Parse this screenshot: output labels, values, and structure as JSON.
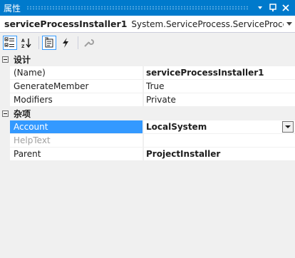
{
  "window": {
    "title": "属性",
    "buttons": {
      "dropdown": "▾",
      "pin": "▭",
      "close": "✕"
    }
  },
  "object_selector": {
    "name": "serviceProcessInstaller1",
    "type": "System.ServiceProcess.ServiceProcessInsta"
  },
  "toolbar": {
    "items": [
      {
        "id": "categorized",
        "icon": "categorized-icon",
        "active": true
      },
      {
        "id": "alphabetical",
        "icon": "alphabetical-icon",
        "active": false
      },
      {
        "id": "properties",
        "icon": "properties-icon",
        "active": true
      },
      {
        "id": "events",
        "icon": "events-lightning-icon",
        "active": false
      },
      {
        "id": "property-pages",
        "icon": "property-pages-wrench-icon",
        "active": false
      }
    ]
  },
  "grid": {
    "categories": [
      {
        "label": "设计",
        "expander": "⊟",
        "properties": [
          {
            "name": "(Name)",
            "value": "serviceProcessInstaller1"
          },
          {
            "name": "GenerateMember",
            "value": "True"
          },
          {
            "name": "Modifiers",
            "value": "Private"
          }
        ]
      },
      {
        "label": "杂项",
        "expander": "⊟",
        "properties": [
          {
            "name": "Account",
            "value": "LocalSystem"
          },
          {
            "name": "HelpText",
            "value": ""
          },
          {
            "name": "Parent",
            "value": "ProjectInstaller"
          }
        ]
      }
    ]
  },
  "colors": {
    "titlebar": "#007acc",
    "selection": "#3399ff",
    "background": "#f0f0f0"
  }
}
